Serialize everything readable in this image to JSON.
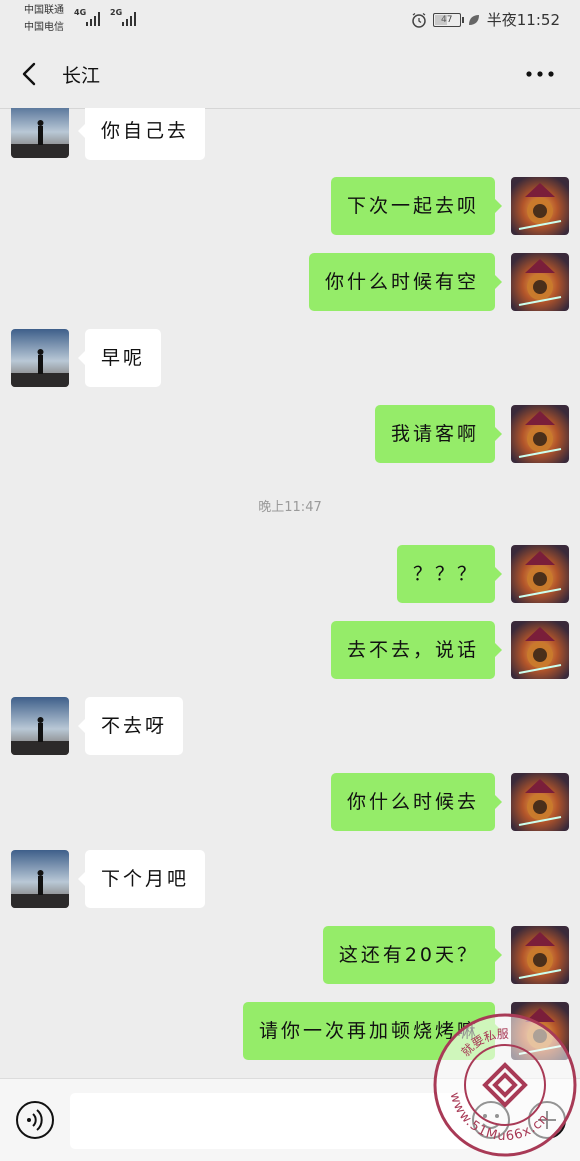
{
  "status_bar": {
    "carrier_1": "中国联通",
    "carrier_2": "中国电信",
    "net_1": "4G",
    "net_2": "2G",
    "battery": "47",
    "time": "半夜11:52"
  },
  "header": {
    "title": "长江",
    "back_icon": "chevron-left-icon",
    "more_icon": "more-dots-icon"
  },
  "messages": [
    {
      "side": "in",
      "text": "你自己去"
    },
    {
      "side": "out",
      "text": "下次一起去呗"
    },
    {
      "side": "out",
      "text": "你什么时候有空"
    },
    {
      "side": "in",
      "text": "早呢"
    },
    {
      "side": "out",
      "text": "我请客啊"
    },
    {
      "side": "out",
      "text": "？？？"
    },
    {
      "side": "out",
      "text": "去不去，说话"
    },
    {
      "side": "in",
      "text": "不去呀"
    },
    {
      "side": "out",
      "text": "你什么时候去"
    },
    {
      "side": "in",
      "text": "下个月吧"
    },
    {
      "side": "out",
      "text": "这还有20天？"
    },
    {
      "side": "out",
      "text": "请你一次再加顿烧烤嘛"
    }
  ],
  "timestamp": "晚上11:47",
  "input_bar": {
    "voice_icon": "voice-icon",
    "emoji_icon": "emoji-icon",
    "plus_icon": "plus-icon"
  },
  "watermark": {
    "text_arc": "www.51Mu66x.cn",
    "text_top": "就要私服"
  },
  "colors": {
    "background": "#ededed",
    "bubble_out": "#95ec69",
    "bubble_in": "#ffffff"
  }
}
